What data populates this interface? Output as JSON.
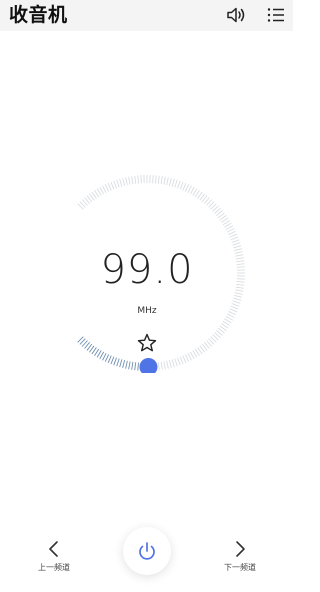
{
  "app": {
    "title": "收音机"
  },
  "icons": {
    "volume": "speaker-icon",
    "menu": "list-menu-icon",
    "favorite": "star-outline-icon",
    "prev": "chevron-left-icon",
    "next": "chevron-right-icon",
    "power": "power-icon"
  },
  "tuner": {
    "frequency": "99.0",
    "unit": "MHz",
    "dial_progress": 0.17
  },
  "controls": {
    "prev_label": "上一频道",
    "next_label": "下一频道"
  },
  "colors": {
    "accent": "#4f74e6",
    "arc_active": "#6f8fb0",
    "arc_inactive": "#d8dde0"
  }
}
